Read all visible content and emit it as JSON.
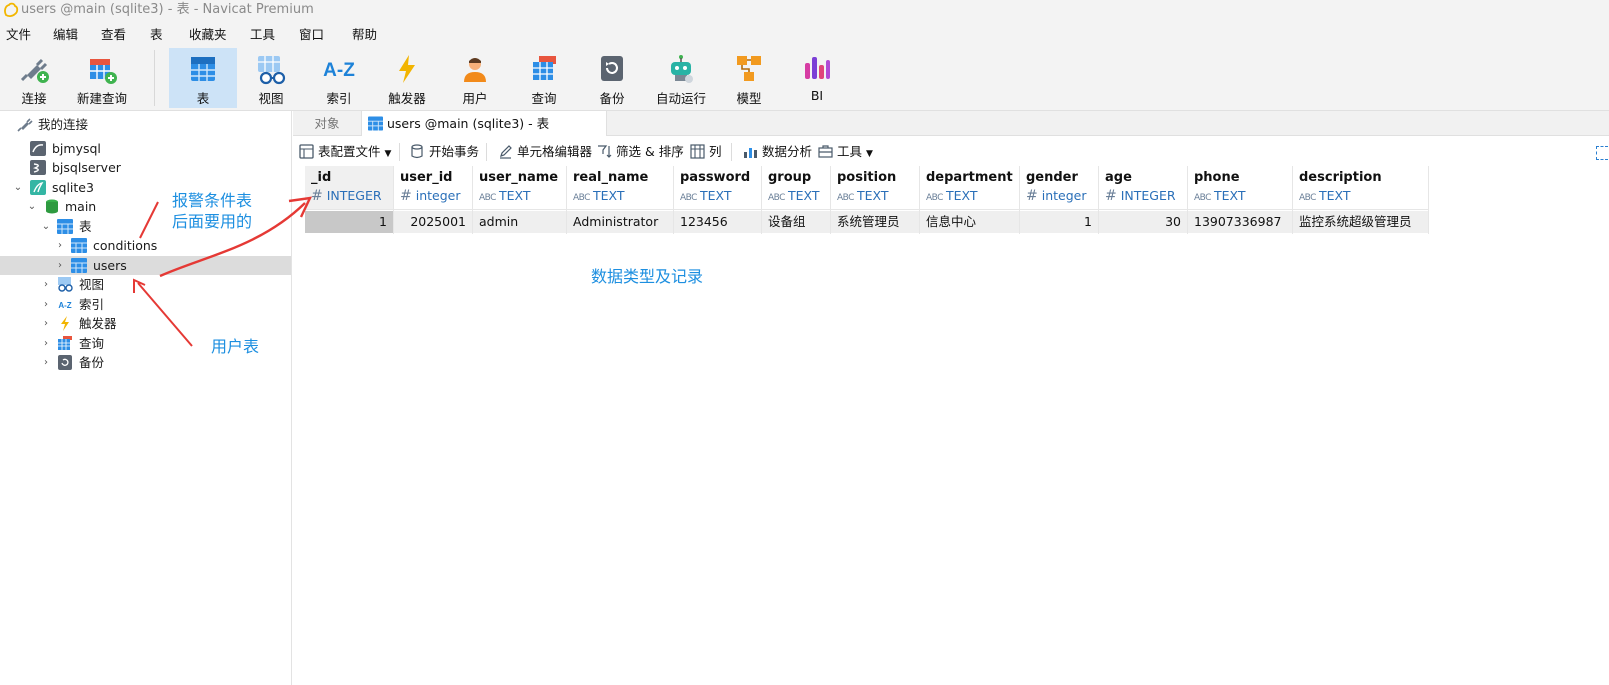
{
  "window": {
    "title": "users @main (sqlite3) - 表 - Navicat Premium"
  },
  "menu": [
    "文件",
    "编辑",
    "查看",
    "表",
    "收藏夹",
    "工具",
    "窗口",
    "帮助"
  ],
  "toolbar": {
    "buttons": [
      {
        "label": "连接",
        "icon": "connection-plug-icon"
      },
      {
        "label": "新建查询",
        "icon": "new-query-icon"
      },
      {
        "label": "表",
        "icon": "table-icon",
        "active": true
      },
      {
        "label": "视图",
        "icon": "view-glasses-icon"
      },
      {
        "label": "索引",
        "icon": "index-az-icon"
      },
      {
        "label": "触发器",
        "icon": "trigger-bolt-icon"
      },
      {
        "label": "用户",
        "icon": "user-icon"
      },
      {
        "label": "查询",
        "icon": "query-icon"
      },
      {
        "label": "备份",
        "icon": "backup-icon"
      },
      {
        "label": "自动运行",
        "icon": "robot-icon"
      },
      {
        "label": "模型",
        "icon": "model-icon"
      },
      {
        "label": "BI",
        "icon": "bi-chart-icon"
      }
    ]
  },
  "sidebar": {
    "root": "我的连接",
    "connections": [
      "bjmysql",
      "bjsqlserver",
      "sqlite3"
    ],
    "database": "main",
    "tables_group": "表",
    "tables": [
      "conditions",
      "users"
    ],
    "selected_table": "users",
    "groups": [
      "视图",
      "索引",
      "触发器",
      "查询",
      "备份"
    ]
  },
  "tabs": {
    "objects": "对象",
    "active": "users @main (sqlite3) - 表"
  },
  "subtoolbar": {
    "table_config": "表配置文件",
    "begin_transaction": "开始事务",
    "cell_editor": "单元格编辑器",
    "filter_sort": "筛选 & 排序",
    "columns": "列",
    "data_analysis": "数据分析",
    "tools": "工具"
  },
  "grid": {
    "columns": [
      {
        "name": "_id",
        "type": "INTEGER",
        "kind": "num"
      },
      {
        "name": "user_id",
        "type": "integer",
        "kind": "num"
      },
      {
        "name": "user_name",
        "type": "TEXT",
        "kind": "text"
      },
      {
        "name": "real_name",
        "type": "TEXT",
        "kind": "text"
      },
      {
        "name": "password",
        "type": "TEXT",
        "kind": "text"
      },
      {
        "name": "group",
        "type": "TEXT",
        "kind": "text"
      },
      {
        "name": "position",
        "type": "TEXT",
        "kind": "text"
      },
      {
        "name": "department",
        "type": "TEXT",
        "kind": "text"
      },
      {
        "name": "gender",
        "type": "integer",
        "kind": "num"
      },
      {
        "name": "age",
        "type": "INTEGER",
        "kind": "num"
      },
      {
        "name": "phone",
        "type": "TEXT",
        "kind": "text"
      },
      {
        "name": "description",
        "type": "TEXT",
        "kind": "text"
      }
    ],
    "rows": [
      [
        "1",
        "2025001",
        "admin",
        "Administrator",
        "123456",
        "设备组",
        "系统管理员",
        "信息中心",
        "1",
        "30",
        "13907336987",
        "监控系统超级管理员"
      ]
    ]
  },
  "annotations": {
    "conditions_note_line1": "报警条件表",
    "conditions_note_line2": "后面要用的",
    "users_note": "用户表",
    "grid_note": "数据类型及记录"
  },
  "colors": {
    "annotation": "#1d8fe0",
    "arrow": "#e53935",
    "selected_toolbar": "#cde3f7"
  }
}
